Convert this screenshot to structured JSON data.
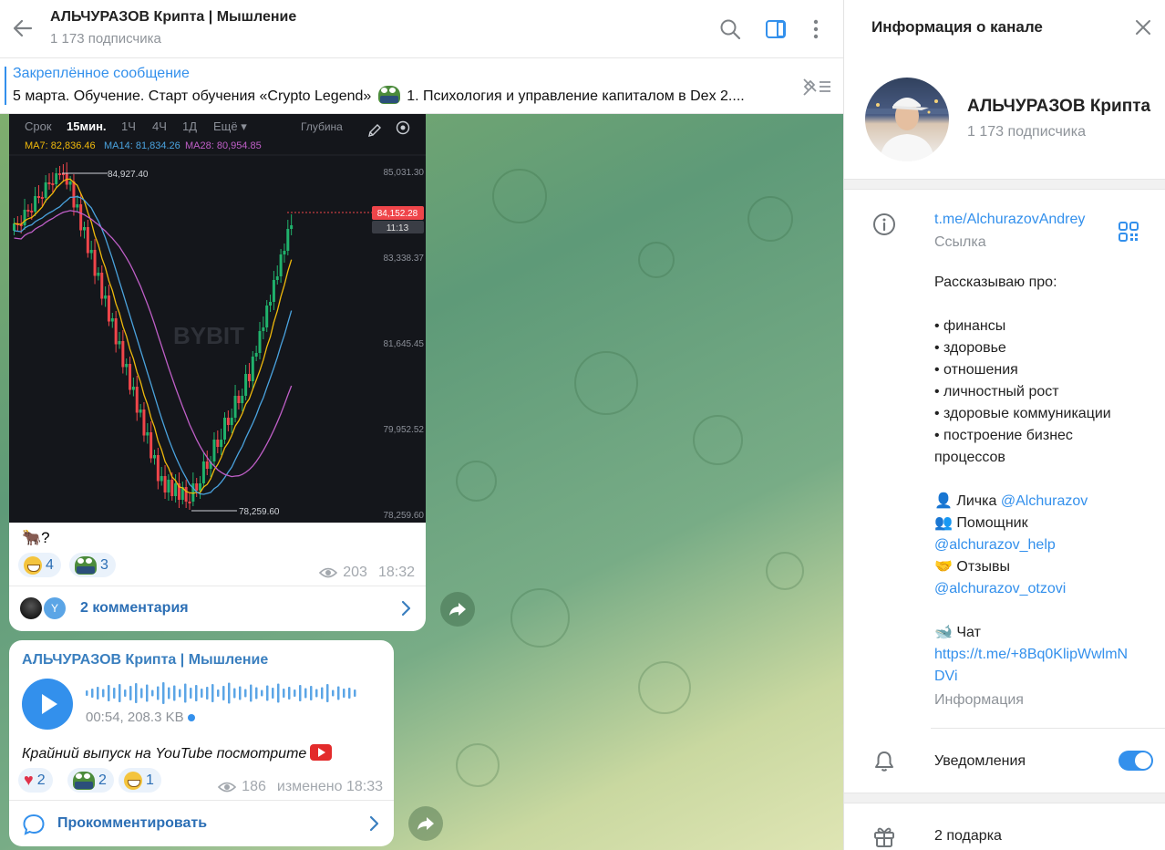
{
  "header": {
    "title": "АЛЬЧУРАЗОВ Крипта | Мышление",
    "subtitle": "1 173 подписчика"
  },
  "pinned": {
    "title": "Закреплённое сообщение",
    "text_before": "5 марта. Обучение.  Старт обучения «Crypto Legend»",
    "text_after": " 1. Психология и управление капиталом в Dex  2...."
  },
  "chart_screenshot": {
    "tabs": [
      "Срок",
      "15мин.",
      "1Ч",
      "4Ч",
      "1Д",
      "Ещё"
    ],
    "active_tab": "15мин.",
    "depth_label": "Глубина",
    "ma7": "MA7: 82,836.46",
    "ma14": "MA14: 81,834.26",
    "ma28": "MA28: 80,954.85",
    "high_label": "84,927.40",
    "low_label": "78,259.60",
    "price_tag": "84,152.28",
    "timer": "11:13",
    "axis_prices": [
      "85,031.30",
      "83,338.37",
      "81,645.45",
      "79,952.52",
      "78,259.60"
    ],
    "watermark": "BYBIT",
    "colors": {
      "up": "#20b26c",
      "down": "#ef454a",
      "ma7": "#f0b90b",
      "ma14": "#4aa3df",
      "ma28": "#c05fc8"
    }
  },
  "post1": {
    "caption": "🐂?",
    "reactions": [
      {
        "emoji": "smile",
        "count": "4"
      },
      {
        "emoji": "pepe",
        "count": "3"
      }
    ],
    "views": "203",
    "time": "18:32",
    "comments_label": "2 комментария",
    "commenter_initial": "Y"
  },
  "post2": {
    "author": "АЛЬЧУРАЗОВ Крипта | Мышление",
    "voice_meta": "00:54, 208.3 KB",
    "text": "Крайний выпуск на YouTube посмотрите",
    "reactions": [
      {
        "emoji": "heart",
        "count": "2"
      },
      {
        "emoji": "pepe",
        "count": "2"
      },
      {
        "emoji": "smile",
        "count": "1"
      }
    ],
    "views": "186",
    "time": "изменено 18:33",
    "comment_label": "Прокомментировать"
  },
  "panel": {
    "title": "Информация о канале",
    "name": "АЛЬЧУРАЗОВ Крипта | Мышление",
    "subscribers": "1 173 подписчика",
    "link": "t.me/AlchurazovAndrey",
    "link_label": "Ссылка",
    "about_intro": "Рассказываю про:",
    "about_items": [
      "• финансы",
      "• здоровье",
      "• отношения",
      "• личностный рост",
      "• здоровые коммуникации",
      "• построение бизнес",
      "процессов"
    ],
    "contact1_prefix": "👤 Личка ",
    "contact1_handle": "@Alchurazov",
    "contact2_prefix": "👥 Помощник",
    "contact2_handle": "@alchurazov_help",
    "contact3_prefix": "🤝 Отзывы",
    "contact3_handle": "@alchurazov_otzovi",
    "chat_prefix": "🐋 Чат",
    "chat_link_1": "https://t.me/+8Bq0KlipWwlmN",
    "chat_link_2": "DVi",
    "info_label": "Информация",
    "notifications_label": "Уведомления",
    "notifications_on": true,
    "gifts_label": "2 подарка"
  }
}
